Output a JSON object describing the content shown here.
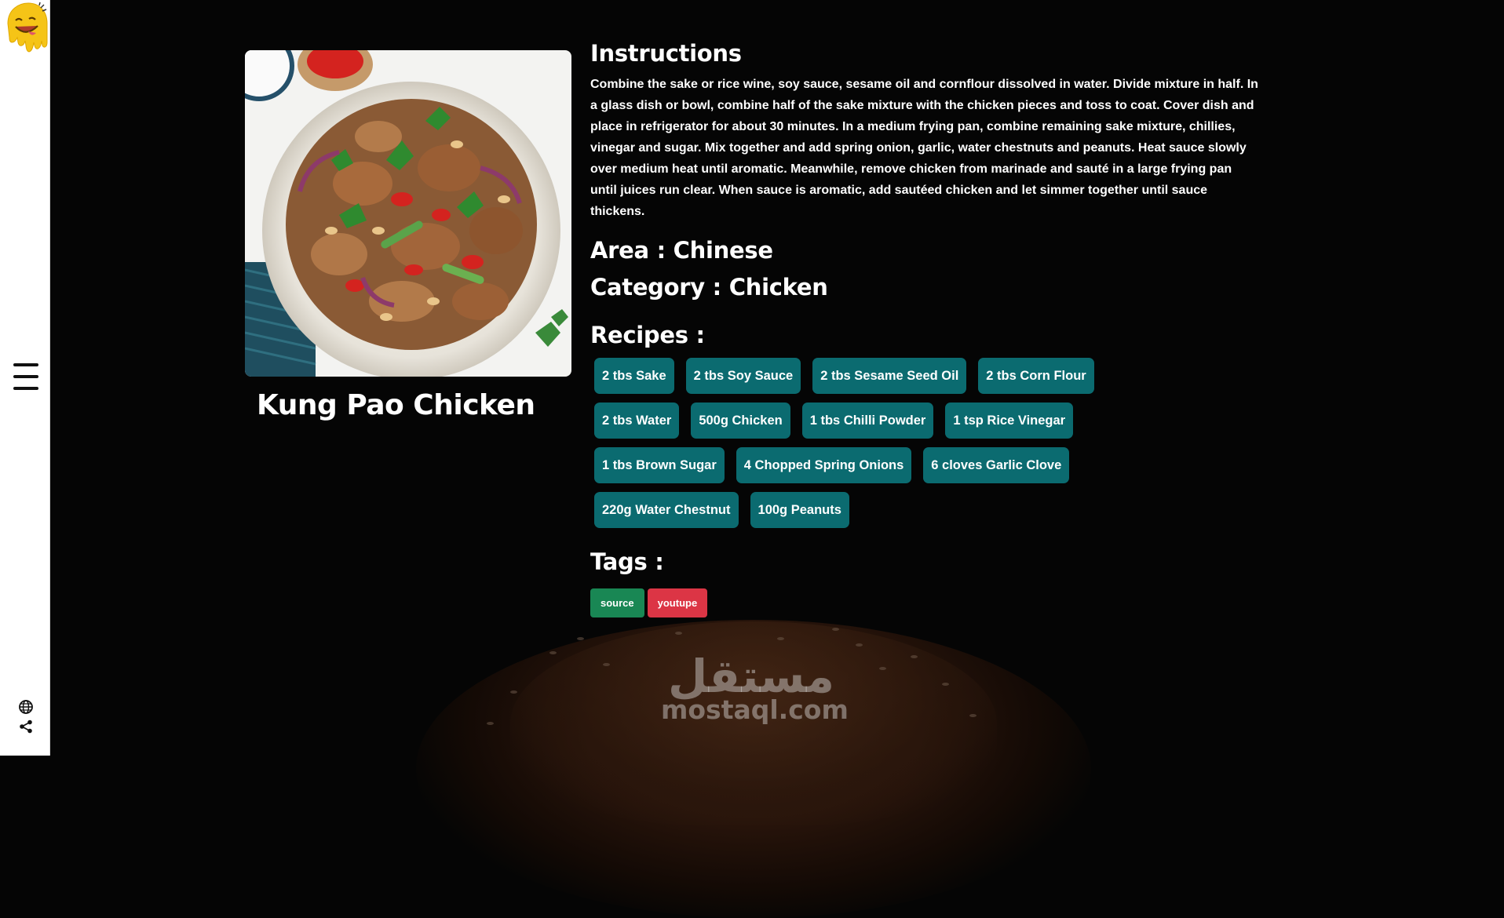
{
  "sidebar": {
    "logo_icon": "smiley-drip-logo",
    "menu_icon": "hamburger-icon",
    "globe_icon": "globe-icon",
    "share_icon": "share-icon"
  },
  "meal": {
    "name": "Kung Pao Chicken",
    "image_alt": "Kung Pao Chicken"
  },
  "instructions": {
    "heading": "Instructions",
    "text": "Combine the sake or rice wine, soy sauce, sesame oil and cornflour dissolved in water. Divide mixture in half. In a glass dish or bowl, combine half of the sake mixture with the chicken pieces and toss to coat. Cover dish and place in refrigerator for about 30 minutes. In a medium frying pan, combine remaining sake mixture, chillies, vinegar and sugar. Mix together and add spring onion, garlic, water chestnuts and peanuts. Heat sauce slowly over medium heat until aromatic. Meanwhile, remove chicken from marinade and sauté in a large frying pan until juices run clear. When sauce is aromatic, add sautéed chicken and let simmer together until sauce thickens."
  },
  "area_line": "Area : Chinese",
  "category_line": "Category : Chicken",
  "recipes": {
    "heading": "Recipes :",
    "items": [
      "2 tbs Sake",
      "2 tbs Soy Sauce",
      "2 tbs Sesame Seed Oil",
      "2 tbs Corn Flour",
      "2 tbs Water",
      "500g Chicken",
      "1 tbs Chilli Powder",
      "1 tsp Rice Vinegar",
      "1 tbs Brown Sugar",
      "4 Chopped Spring Onions",
      "6 cloves Garlic Clove",
      "220g Water Chestnut",
      "100g Peanuts"
    ]
  },
  "tags": {
    "heading": "Tags :",
    "source_label": "source",
    "youtube_label": "youtupe",
    "source_color": "#198754",
    "youtube_color": "#dc3545"
  },
  "watermark": {
    "arabic": "مستقل",
    "latin": "mostaql.com"
  },
  "colors": {
    "background": "#050505",
    "ingredient_badge": "#0b6b70",
    "sidebar": "#ffffff"
  }
}
